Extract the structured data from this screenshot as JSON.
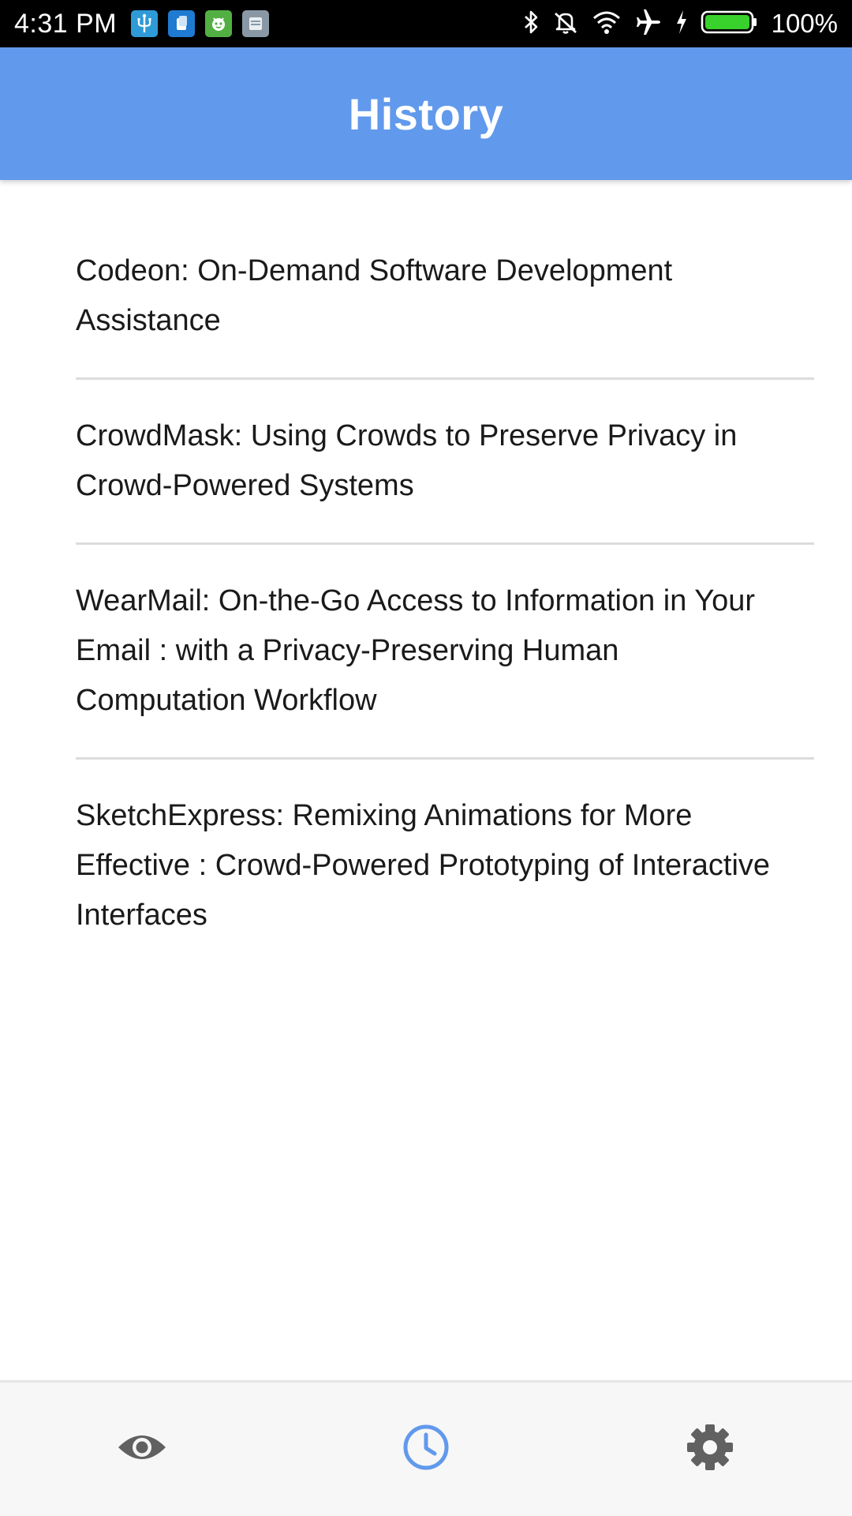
{
  "status_bar": {
    "time": "4:31 PM",
    "battery_percent": "100%",
    "notification_icons": [
      "usb-debug-icon",
      "blue-app-icon",
      "android-icon",
      "storage-icon"
    ],
    "system_icons": [
      "bluetooth-icon",
      "mute-icon",
      "wifi-icon",
      "airplane-icon",
      "charging-icon",
      "battery-icon"
    ]
  },
  "app_bar": {
    "title": "History",
    "color": "#6199ec"
  },
  "history": {
    "items": [
      {
        "title": "Codeon: On-Demand Software Development Assistance"
      },
      {
        "title": "CrowdMask: Using Crowds to Preserve Privacy in Crowd-Powered Systems"
      },
      {
        "title": "WearMail: On-the-Go Access to Information in Your Email : with a Privacy-Preserving Human Computation Workflow"
      },
      {
        "title": "SketchExpress: Remixing Animations for More Effective : Crowd-Powered Prototyping of Interactive Interfaces"
      }
    ]
  },
  "bottom_nav": {
    "items": [
      {
        "icon": "eye-icon",
        "selected": false
      },
      {
        "icon": "clock-icon",
        "selected": true
      },
      {
        "icon": "gear-icon",
        "selected": false
      }
    ],
    "selected_color": "#6199ec",
    "unselected_color": "#616161"
  }
}
